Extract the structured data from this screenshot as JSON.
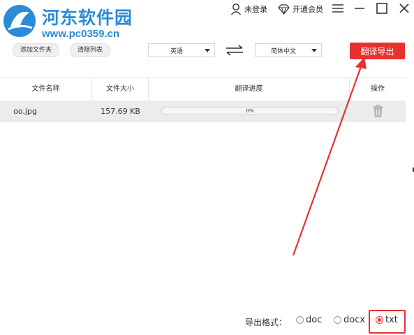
{
  "watermark": {
    "title": "河东软件园",
    "url": "www.pc0359.cn"
  },
  "header": {
    "user_label": "未登录",
    "vip_label": "开通会员",
    "icons": [
      "user-icon",
      "diamond-icon",
      "menu-icon",
      "minimize-icon",
      "maximize-icon",
      "close-icon"
    ]
  },
  "toolbar": {
    "add_folder_label": "添加文件夹",
    "clear_list_label": "清除列表",
    "source_lang": "英语",
    "target_lang": "简体中文",
    "translate_export_label": "翻译导出"
  },
  "table": {
    "headers": [
      "文件名称",
      "文件大小",
      "翻译进度",
      "操作"
    ],
    "rows": [
      {
        "name": "oo.jpg",
        "size": "157.69 KB",
        "progress_text": "0%",
        "progress": 0
      }
    ]
  },
  "export": {
    "label": "导出格式：",
    "options": [
      "doc",
      "docx",
      "txt"
    ],
    "selected": "txt"
  },
  "colors": {
    "accent_red": "#e8312f",
    "watermark_blue": "#2a8bd6"
  }
}
